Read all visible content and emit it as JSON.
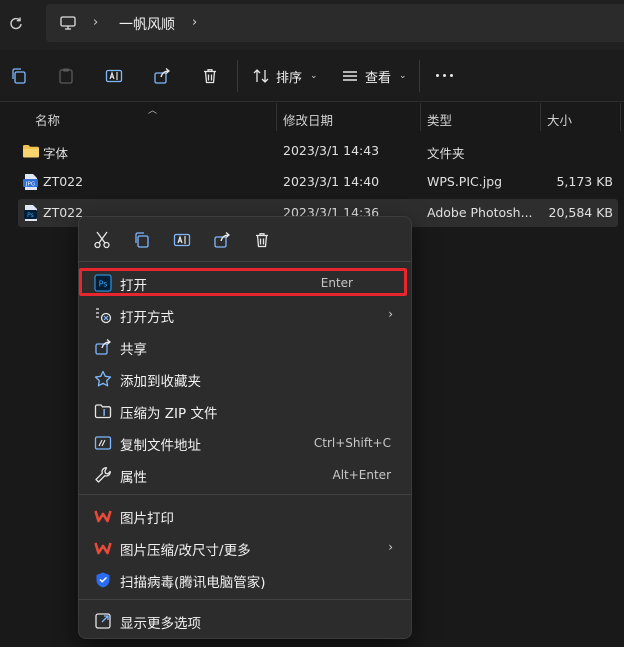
{
  "address": {
    "crumb": "一帆风顺"
  },
  "toolbar": {
    "sort_label": "排序",
    "view_label": "查看"
  },
  "columns": {
    "name": "名称",
    "date": "修改日期",
    "type": "类型",
    "size": "大小"
  },
  "rows": [
    {
      "name": "字体",
      "date": "2023/3/1 14:43",
      "type": "文件夹",
      "size": ""
    },
    {
      "name": "ZT022",
      "date": "2023/3/1 14:40",
      "type": "WPS.PIC.jpg",
      "size": "5,173 KB",
      "icon_text": "JPG"
    },
    {
      "name": "ZT022",
      "date": "2023/3/1 14:36",
      "type": "Adobe Photosh...",
      "size": "20,584 KB",
      "icon_text": "Ps"
    }
  ],
  "menu": {
    "items": [
      {
        "label": "打开",
        "shortcut": "Enter",
        "icon_text": "Ps"
      },
      {
        "label": "打开方式",
        "shortcut": ""
      },
      {
        "label": "共享",
        "shortcut": ""
      },
      {
        "label": "添加到收藏夹",
        "shortcut": ""
      },
      {
        "label": "压缩为 ZIP 文件",
        "shortcut": ""
      },
      {
        "label": "复制文件地址",
        "shortcut": "Ctrl+Shift+C"
      },
      {
        "label": "属性",
        "shortcut": "Alt+Enter"
      },
      {
        "label": "图片打印",
        "shortcut": ""
      },
      {
        "label": "图片压缩/改尺寸/更多",
        "shortcut": ""
      },
      {
        "label": "扫描病毒(腾讯电脑管家)",
        "shortcut": ""
      },
      {
        "label": "显示更多选项",
        "shortcut": ""
      }
    ]
  },
  "colors": {
    "accent": "#e8262d",
    "folder": "#f2c14e",
    "ps_blue": "#31a8ff",
    "wps_red": "#e84a3a"
  }
}
